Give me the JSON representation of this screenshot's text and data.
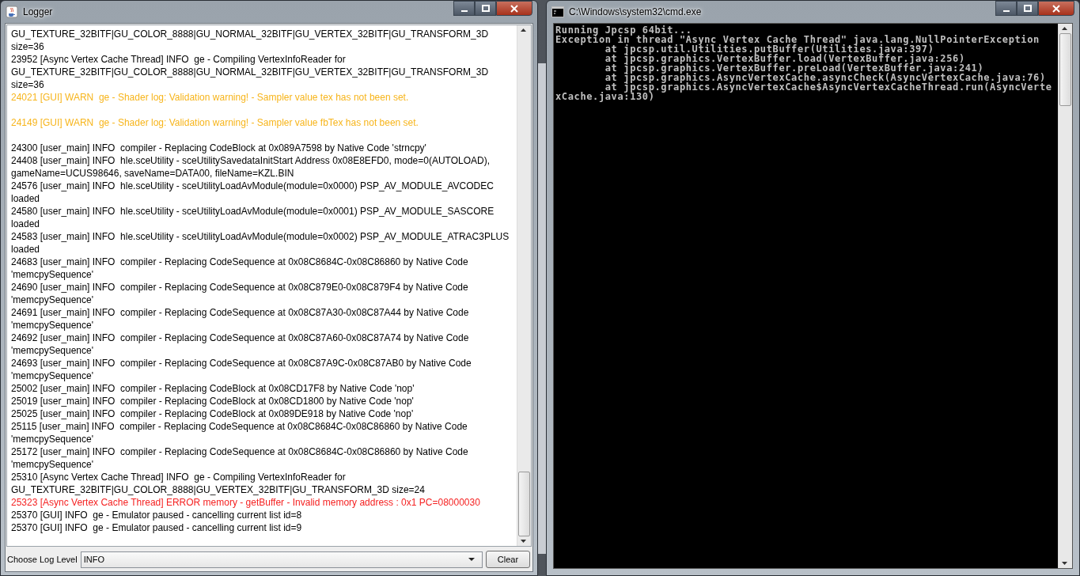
{
  "logger": {
    "title": "Logger",
    "entries": [
      {
        "kind": "info",
        "text": "GU_TEXTURE_32BITF|GU_COLOR_8888|GU_NORMAL_32BITF|GU_VERTEX_32BITF|GU_TRANSFORM_3D size=36"
      },
      {
        "kind": "info",
        "text": "23952 [Async Vertex Cache Thread] INFO  ge - Compiling VertexInfoReader for GU_TEXTURE_32BITF|GU_COLOR_8888|GU_NORMAL_32BITF|GU_VERTEX_32BITF|GU_TRANSFORM_3D size=36"
      },
      {
        "kind": "warn",
        "text": "24021 [GUI] WARN  ge - Shader log: Validation warning! - Sampler value tex has not been set."
      },
      {
        "kind": "warn",
        "text": "24149 [GUI] WARN  ge - Shader log: Validation warning! - Sampler value fbTex has not been set."
      },
      {
        "kind": "info",
        "text": "24300 [user_main] INFO  compiler - Replacing CodeBlock at 0x089A7598 by Native Code 'strncpy'"
      },
      {
        "kind": "info",
        "text": "24408 [user_main] INFO  hle.sceUtility - sceUtilitySavedataInitStart Address 0x08E8EFD0, mode=0(AUTOLOAD), gameName=UCUS98646, saveName=DATA00, fileName=KZL.BIN"
      },
      {
        "kind": "info",
        "text": "24576 [user_main] INFO  hle.sceUtility - sceUtilityLoadAvModule(module=0x0000) PSP_AV_MODULE_AVCODEC loaded"
      },
      {
        "kind": "info",
        "text": "24580 [user_main] INFO  hle.sceUtility - sceUtilityLoadAvModule(module=0x0001) PSP_AV_MODULE_SASCORE loaded"
      },
      {
        "kind": "info",
        "text": "24583 [user_main] INFO  hle.sceUtility - sceUtilityLoadAvModule(module=0x0002) PSP_AV_MODULE_ATRAC3PLUS loaded"
      },
      {
        "kind": "info",
        "text": "24683 [user_main] INFO  compiler - Replacing CodeSequence at 0x08C8684C-0x08C86860 by Native Code 'memcpySequence'"
      },
      {
        "kind": "info",
        "text": "24690 [user_main] INFO  compiler - Replacing CodeSequence at 0x08C879E0-0x08C879F4 by Native Code 'memcpySequence'"
      },
      {
        "kind": "info",
        "text": "24691 [user_main] INFO  compiler - Replacing CodeSequence at 0x08C87A30-0x08C87A44 by Native Code 'memcpySequence'"
      },
      {
        "kind": "info",
        "text": "24692 [user_main] INFO  compiler - Replacing CodeSequence at 0x08C87A60-0x08C87A74 by Native Code 'memcpySequence'"
      },
      {
        "kind": "info",
        "text": "24693 [user_main] INFO  compiler - Replacing CodeSequence at 0x08C87A9C-0x08C87AB0 by Native Code 'memcpySequence'"
      },
      {
        "kind": "info",
        "text": "25002 [user_main] INFO  compiler - Replacing CodeBlock at 0x08CD17F8 by Native Code 'nop'"
      },
      {
        "kind": "info",
        "text": "25019 [user_main] INFO  compiler - Replacing CodeBlock at 0x08CD1800 by Native Code 'nop'"
      },
      {
        "kind": "info",
        "text": "25025 [user_main] INFO  compiler - Replacing CodeBlock at 0x089DE918 by Native Code 'nop'"
      },
      {
        "kind": "info",
        "text": "25115 [user_main] INFO  compiler - Replacing CodeSequence at 0x08C8684C-0x08C86860 by Native Code 'memcpySequence'"
      },
      {
        "kind": "info",
        "text": "25172 [user_main] INFO  compiler - Replacing CodeSequence at 0x08C8684C-0x08C86860 by Native Code 'memcpySequence'"
      },
      {
        "kind": "info",
        "text": "25310 [Async Vertex Cache Thread] INFO  ge - Compiling VertexInfoReader for GU_TEXTURE_32BITF|GU_COLOR_8888|GU_VERTEX_32BITF|GU_TRANSFORM_3D size=24"
      },
      {
        "kind": "error",
        "text": "25323 [Async Vertex Cache Thread] ERROR memory - getBuffer - Invalid memory address : 0x1 PC=08000030"
      },
      {
        "kind": "info",
        "text": "25370 [GUI] INFO  ge - Emulator paused - cancelling current list id=8"
      },
      {
        "kind": "info",
        "text": "25370 [GUI] INFO  ge - Emulator paused - cancelling current list id=9"
      }
    ],
    "level_label": "Choose Log Level",
    "level_value": "INFO",
    "clear_button": "Clear"
  },
  "console": {
    "title": "C:\\Windows\\system32\\cmd.exe",
    "lines": [
      "Running Jpcsp 64bit...",
      "Exception in thread \"Async Vertex Cache Thread\" java.lang.NullPointerException",
      "        at jpcsp.util.Utilities.putBuffer(Utilities.java:397)",
      "        at jpcsp.graphics.VertexBuffer.load(VertexBuffer.java:256)",
      "        at jpcsp.graphics.VertexBuffer.preLoad(VertexBuffer.java:241)",
      "        at jpcsp.graphics.AsyncVertexCache.asyncCheck(AsyncVertexCache.java:76)",
      "        at jpcsp.graphics.AsyncVertexCache$AsyncVertexCacheThread.run(AsyncVerte",
      "xCache.java:130)"
    ]
  }
}
